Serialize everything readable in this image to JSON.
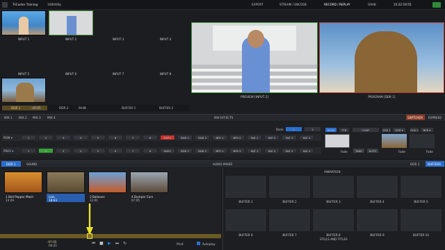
{
  "topbar": {
    "title": "TriCaster Training",
    "resolution": "1080/60p",
    "menus": [
      "EXPORT",
      "STREAM / ENCODE",
      "RECORD / REPLAY",
      "GRAB"
    ],
    "clock": "15:22:19:55"
  },
  "inputs": [
    "INPUT 1",
    "INPUT 2",
    "INPUT 3",
    "INPUT 4",
    "INPUT 5",
    "INPUT 6",
    "INPUT 7",
    "INPUT 8"
  ],
  "monitor_bottom": [
    "DDR 1",
    "DDR 2",
    "BUFFER 1",
    "BUFFER 2"
  ],
  "preview_label": "PREVIEW [INPUT 2]",
  "program_label": "PROGRAM [DDR 1]",
  "status_strip": {
    "ddr1": "DDR 1",
    "time": "-49:05",
    "ddr2": "DDR 2",
    "rec": "9h48"
  },
  "mix_tabs": [
    "MIX 1",
    "MIX 2",
    "MIX 3",
    "MIX 4"
  ],
  "mix_title": "MIX EFFECTS",
  "switcher_tabs": [
    "SWITCHER",
    "EXPRESS"
  ],
  "bank": {
    "label": "Bank",
    "b1": "1",
    "b2": "2"
  },
  "pgm_row": {
    "label": "PGM ▾",
    "buttons": [
      "1",
      "2",
      "3",
      "4",
      "5",
      "6",
      "7",
      "8",
      "DDR1",
      "DDR 1",
      "DDR 2",
      "BFR 1",
      "BFR 2",
      "M/E 1",
      "M/E 2",
      "M/E 3",
      "M/E 4"
    ]
  },
  "prev_row": {
    "label": "PREV ▾",
    "buttons": [
      "1",
      "2",
      "3",
      "4",
      "5",
      "6",
      "7",
      "8",
      "DDR1",
      "DDR 1",
      "DDR 2",
      "BFR 1",
      "BFR 2",
      "M/E 1",
      "M/E 2",
      "M/E 3",
      "M/E 4"
    ]
  },
  "transition": {
    "bkgd": "BKGD",
    "ftb": "FTB",
    "comp": "COMP",
    "fade": "Fade",
    "take": "TAKE",
    "auto": "AUTO",
    "dsk1": "DSK 1",
    "dsk2": "DSK 2",
    "dsk1v": "DDR ▾",
    "dsk2v": "BFR ▾"
  },
  "media_tabs": {
    "ddr": "DDR 1",
    "sound": "SOUND",
    "audio_mixer": "AUDIO MIXER",
    "ddr3": "DDR 3",
    "buffers": "BUFFERS"
  },
  "clips": [
    {
      "name": "1 Bell Pepper Mash",
      "time": "13:29"
    },
    {
      "name": "Lion",
      "time": "18:03"
    },
    {
      "name": "3 Balloons",
      "time": "12:01"
    },
    {
      "name": "4 Bumper Cars",
      "time": "07:05"
    }
  ],
  "buffers": {
    "animation": "ANIMATION",
    "row1": [
      "BUFFER 1",
      "BUFFER 2",
      "BUFFER 3",
      "BUFFER 4",
      "BUFFER 5"
    ],
    "row2": [
      "BUFFER 6",
      "BUFFER 7",
      "BUFFER 8",
      "BUFFER 9",
      "BUFFER 10"
    ],
    "stills": "STILLS AND TITLES"
  },
  "transport": {
    "time1": "-07:05",
    "time2": "04:21",
    "print": "Print",
    "autoplay": "Autoplay"
  },
  "colors": {
    "accent": "#2a6fd0",
    "red": "#c8332b",
    "green": "#3aa13a",
    "orange": "#e06a2b",
    "yellow": "#e8e02a"
  }
}
